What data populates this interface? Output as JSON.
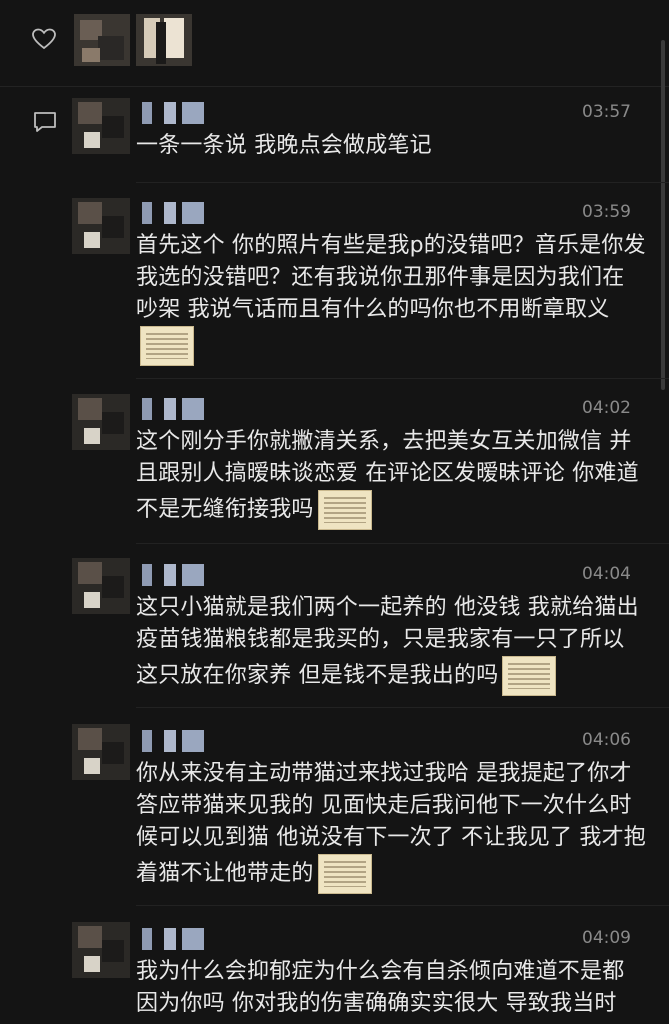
{
  "comments": [
    {
      "time": "03:57",
      "text": "一条一条说 我晚点会做成笔记",
      "attachment": false
    },
    {
      "time": "03:59",
      "text": "首先这个 你的照片有些是我p的没错吧？音乐是你发我选的没错吧？还有我说你丑那件事是因为我们在吵架 我说气话而且有什么的吗你也不用断章取义",
      "attachment": true
    },
    {
      "time": "04:02",
      "text": "这个刚分手你就撇清关系，去把美女互关加微信 并且跟别人搞暧昧谈恋爱 在评论区发暧昧评论 你难道不是无缝衔接我吗",
      "attachment": true
    },
    {
      "time": "04:04",
      "text": "这只小猫就是我们两个一起养的 他没钱 我就给猫出疫苗钱猫粮钱都是我买的，只是我家有一只了所以这只放在你家养 但是钱不是我出的吗",
      "attachment": true
    },
    {
      "time": "04:06",
      "text": "你从来没有主动带猫过来找过我哈 是我提起了你才答应带猫来见我的 见面快走后我问他下一次什么时候可以见到猫 他说没有下一次了 不让我见了 我才抱着猫不让他带走的",
      "attachment": true
    },
    {
      "time": "04:09",
      "text": "我为什么会抑郁症为什么会有自杀倾向难道不是都因为你吗 你对我的伤害确确实实很大 导致我当时",
      "attachment": false
    }
  ],
  "icons": {
    "like": "heart-icon",
    "comment": "comment-icon"
  },
  "colors": {
    "background": "#141414",
    "text": "#e8e8e8",
    "time": "#8a8a8a"
  }
}
